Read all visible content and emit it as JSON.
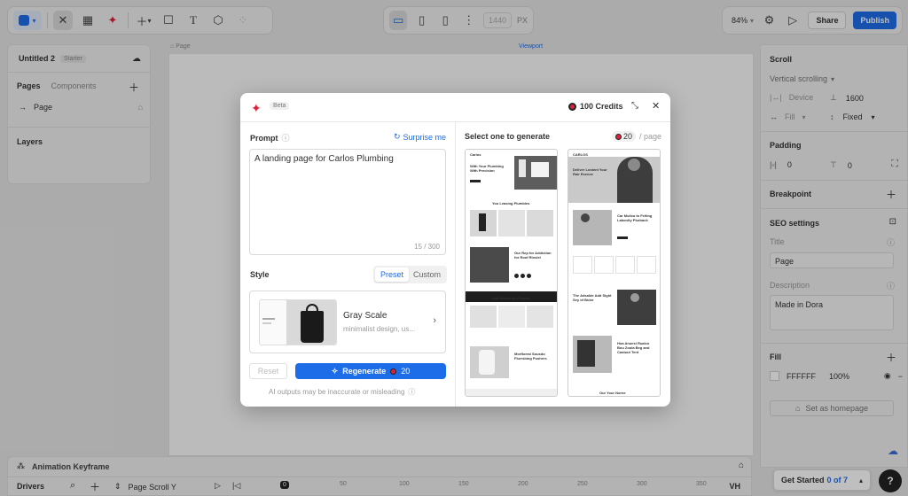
{
  "toolbar": {
    "viewport_width": "1440",
    "viewport_unit": "PX",
    "zoom": "84%",
    "share_label": "Share",
    "publish_label": "Publish"
  },
  "project": {
    "name": "Untitled 2",
    "plan_badge": "Starter"
  },
  "left_panel": {
    "tab_pages": "Pages",
    "tab_components": "Components",
    "page_item": "Page",
    "layers_title": "Layers"
  },
  "canvas": {
    "page_label": "Page",
    "viewport_label": "Viewport"
  },
  "right_panel": {
    "scroll_title": "Scroll",
    "scroll_mode": "Vertical scrolling",
    "device_label": "Device",
    "device_height": "1600",
    "fill_label": "Fill",
    "fixed_label": "Fixed",
    "padding_title": "Padding",
    "padding_x": "0",
    "padding_y": "0",
    "breakpoint_title": "Breakpoint",
    "seo_title": "SEO settings",
    "seo_title_label": "Title",
    "seo_title_value": "Page",
    "description_label": "Description",
    "description_value": "Made in Dora",
    "fill_title": "Fill",
    "fill_hex": "FFFFFF",
    "fill_opacity": "100%",
    "set_homepage": "Set as homepage"
  },
  "bottom": {
    "animation_keyframe": "Animation Keyframe",
    "drivers": "Drivers",
    "page_scroll": "Page Scroll Y",
    "timeline_ticks": [
      "0",
      "50",
      "100",
      "150",
      "200",
      "250",
      "300",
      "350"
    ],
    "vh_label": "VH",
    "get_started": "Get Started",
    "progress": "0 of 7"
  },
  "modal": {
    "beta_badge": "Beta",
    "credits": "100 Credits",
    "prompt_label": "Prompt",
    "surprise_label": "Surprise me",
    "prompt_value": "A landing page for Carlos Plumbing",
    "char_count": "15 / 300",
    "style_label": "Style",
    "preset_tab": "Preset",
    "custom_tab": "Custom",
    "style_name": "Gray Scale",
    "style_desc": "minimalist design, us...",
    "reset_label": "Reset",
    "regenerate_label": "Regenerate",
    "regenerate_cost": "20",
    "disclaimer": "AI outputs may be inaccurate or misleading",
    "select_label": "Select one to generate",
    "per_page_cost": "20",
    "per_page_label": "/ page",
    "preview1": {
      "logo": "Carlos",
      "hero": "With Your Plumbing With Precision",
      "section2": "You Leasing Plumbies",
      "section3": "Our Rep for Addiction for Roof Rinslel",
      "section4": "You Words for Prenna",
      "section5": "Morftorral Sousdo Flurrsbing Pushers"
    },
    "preview2": {
      "logo": "CARLOS",
      "hero": "Deliver Lostent Your Rair Esence",
      "section2": "Car Molica to Felting Labonity Plurback",
      "section3": "The Adsalde Add Sight Sey of Bulor",
      "section4": "Hoa Anuesi Rualco Bou Zoula Beg and Castout Tent",
      "section5": "Our Your Norne"
    }
  },
  "colors": {
    "accent": "#1e6de8",
    "canvas_bg": "#e5e5e5",
    "panel_bg": "#efefef"
  }
}
